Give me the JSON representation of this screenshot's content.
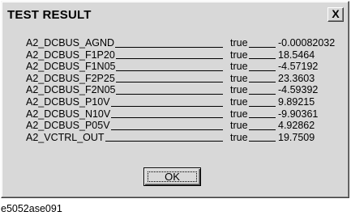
{
  "dialog": {
    "title": "TEST RESULT",
    "close_label": "X"
  },
  "results": [
    {
      "name": "A2_DCBUS_AGND",
      "status": "true",
      "value": "-0.00082032"
    },
    {
      "name": "A2_DCBUS_F1P20",
      "status": "true",
      "value": "18.5464"
    },
    {
      "name": "A2_DCBUS_F1N05",
      "status": "true",
      "value": "-4.57192"
    },
    {
      "name": "A2_DCBUS_F2P25",
      "status": "true",
      "value": "23.3603"
    },
    {
      "name": "A2_DCBUS_F2N05",
      "status": "true",
      "value": "-4.59392"
    },
    {
      "name": "A2_DCBUS_P10V",
      "status": "true",
      "value": "9.89215"
    },
    {
      "name": "A2_DCBUS_N10V",
      "status": "true",
      "value": "-9.90361"
    },
    {
      "name": "A2_DCBUS_P05V",
      "status": "true",
      "value": "4.92862"
    },
    {
      "name": "A2_VCTRL_OUT",
      "status": "true",
      "value": "19.7509"
    }
  ],
  "ok_label": "OK",
  "caption": "e5052ase091"
}
